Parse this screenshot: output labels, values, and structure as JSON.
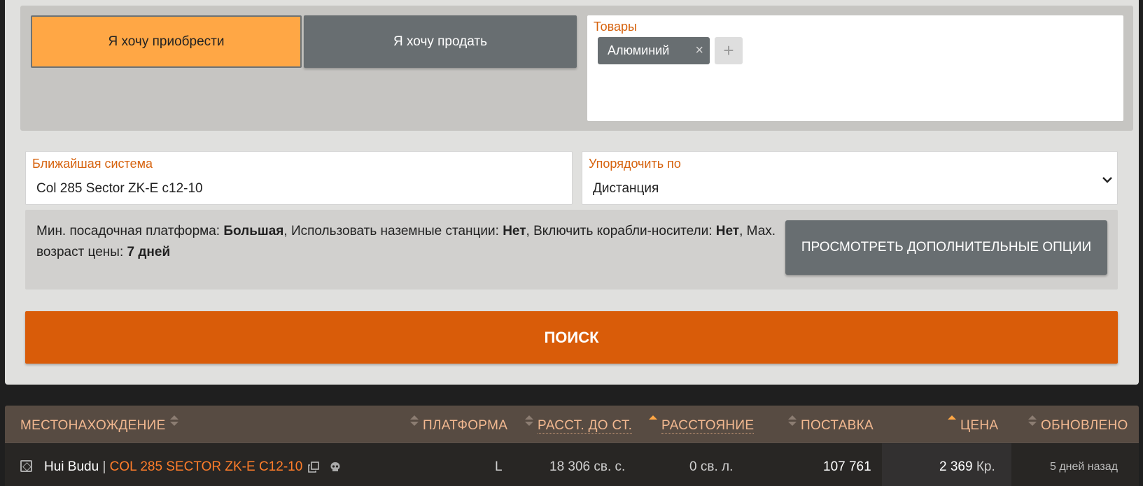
{
  "search_form": {
    "mode_buy": "Я хочу приобрести",
    "mode_sell": "Я хочу продать",
    "goods_label": "Товары",
    "goods": [
      {
        "name": "Алюминий",
        "remove": "×"
      }
    ],
    "add_goods": "+",
    "nearest_system_label": "Ближайшая система",
    "nearest_system_value": "Col 285 Sector ZK-E c12-10",
    "order_by_label": "Упорядочить по",
    "order_by_value": "Дистанция",
    "options": {
      "pad_label": "Мин. посадочная платформа:",
      "pad_value": "Большая",
      "surface_label": "Использовать наземные станции:",
      "surface_value": "Нет",
      "carriers_label": "Включить корабли-носители:",
      "carriers_value": "Нет",
      "age_label": "Мах. возраст цены:",
      "age_value": "7 дней"
    },
    "more_options_button": "ПРОСМОТРЕТЬ ДОПОЛНИТЕЛЬНЫЕ ОПЦИИ",
    "search_button": "ПОИСК"
  },
  "results": {
    "columns": {
      "location": "МЕСТОНАХОЖДЕНИЕ",
      "pad": "ПЛАТФОРМА",
      "dist_to_star": "РАССТ. ДО СТ.",
      "distance": "РАССТОЯНИЕ",
      "supply": "ПОСТАВКА",
      "price": "ЦЕНА",
      "updated": "ОБНОВЛЕНО"
    },
    "rows": [
      {
        "station": "Hui Budu",
        "separator": "|",
        "system": "COL 285 SECTOR ZK-E C12-10",
        "pad": "L",
        "dist_to_star": "18 306 св. с.",
        "distance": "0 св. л.",
        "supply": "107 761",
        "price": "2 369",
        "price_unit": "Кр.",
        "updated": "5 дней назад"
      }
    ]
  },
  "colors": {
    "accent": "#d95c09",
    "selected_mode": "#ffa745",
    "label": "#d6620d",
    "system_link": "#ff7d2a"
  }
}
